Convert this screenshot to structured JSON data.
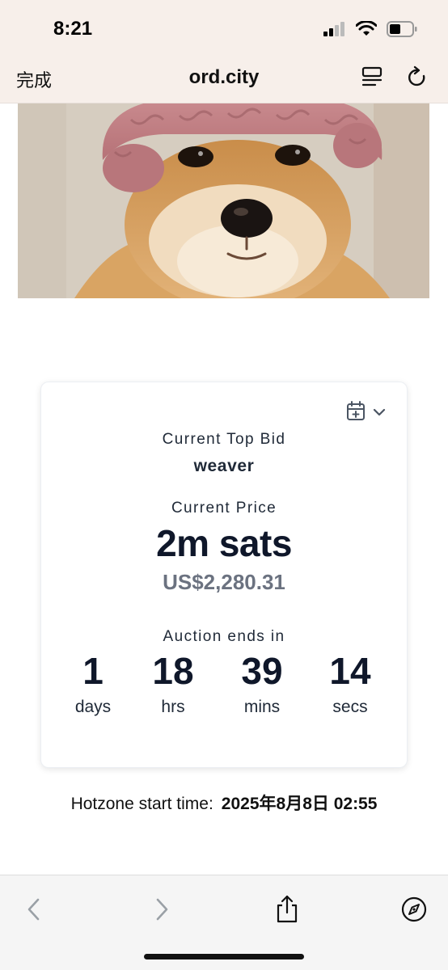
{
  "status_bar": {
    "time": "8:21",
    "icons": [
      "cellular-signal-icon",
      "wifi-icon",
      "battery-icon"
    ]
  },
  "browser": {
    "done_label": "完成",
    "site_title": "ord.city",
    "icons": [
      "reader-list-icon",
      "reload-icon"
    ]
  },
  "hero": {
    "icon": "shiba-dog-pink-hat-image"
  },
  "auction": {
    "top_bid_label": "Current Top Bid",
    "top_bidder": "weaver",
    "price_label": "Current Price",
    "price": "2m sats",
    "price_usd": "US$2,280.31",
    "ends_label": "Auction ends in",
    "countdown": [
      {
        "value": "1",
        "unit": "days"
      },
      {
        "value": "18",
        "unit": "hrs"
      },
      {
        "value": "39",
        "unit": "mins"
      },
      {
        "value": "14",
        "unit": "secs"
      }
    ],
    "calendar_icon": "calendar-plus-icon"
  },
  "hotzone": {
    "label": "Hotzone start time:",
    "value": "2025年8月8日 02:55"
  },
  "toolbar": {
    "icons": [
      "back-chevron-icon",
      "forward-chevron-icon",
      "share-icon",
      "compass-icon"
    ]
  },
  "colors": {
    "header_bg": "#f7efea",
    "text_dark": "#0f172a",
    "usd_gray": "#6b7280",
    "toolbar_bg": "#f5f5f5"
  }
}
